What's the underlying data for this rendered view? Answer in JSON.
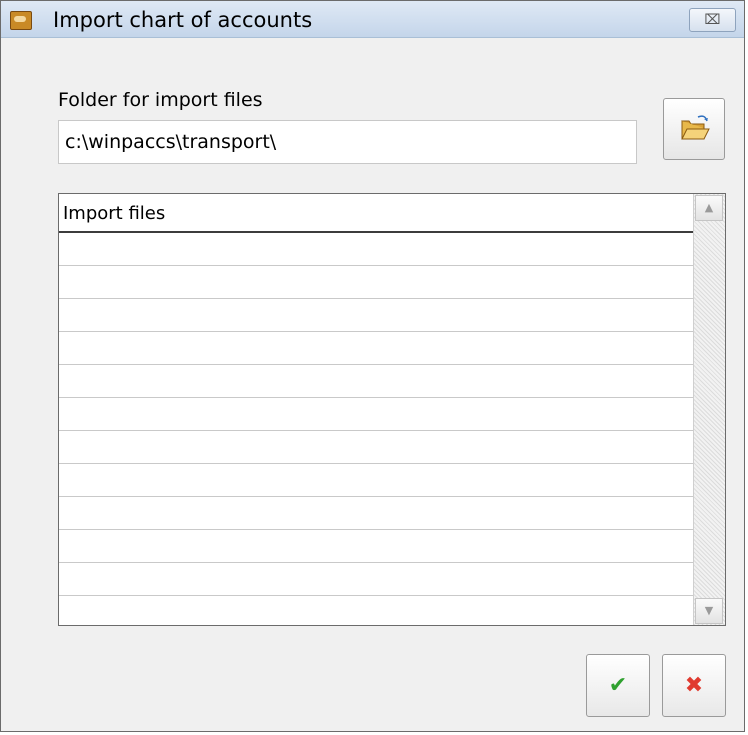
{
  "window": {
    "title": "Import chart of accounts",
    "close_glyph": "⌧",
    "icons": {
      "app": "app-icon",
      "close": "close-icon"
    }
  },
  "folder": {
    "label": "Folder for import files",
    "value": "c:\\winpaccs\\transport\\",
    "browse_icon": "open-folder-icon"
  },
  "grid": {
    "column_header": "Import files",
    "rows": [
      "",
      "",
      "",
      "",
      "",
      "",
      "",
      "",
      "",
      "",
      "",
      ""
    ],
    "scroll_up_glyph": "▲",
    "scroll_down_glyph": "▼"
  },
  "buttons": {
    "ok_glyph": "✔",
    "cancel_glyph": "✖",
    "ok_color": "#2fa12f",
    "cancel_color": "#e03a2f"
  }
}
